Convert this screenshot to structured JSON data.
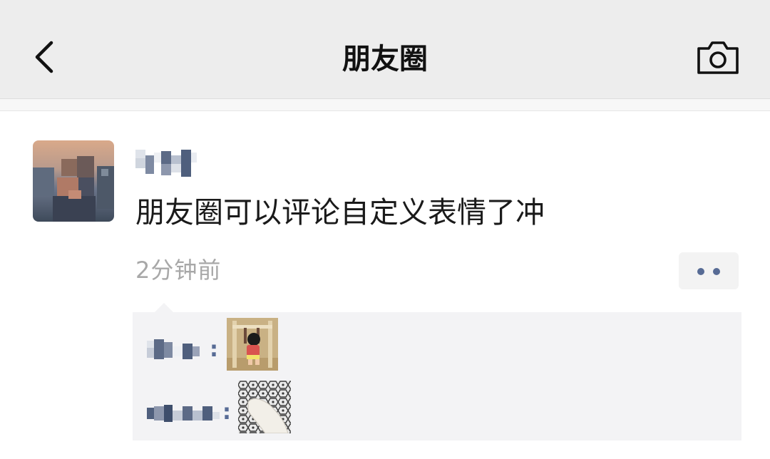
{
  "navbar": {
    "title": "朋友圈",
    "back_icon": "chevron-left-icon",
    "camera_icon": "camera-icon",
    "background": "#ededed"
  },
  "post": {
    "text": "朋友圈可以评论自定义表情了冲",
    "time": "2分钟前",
    "more_icon": "ellipsis-icon"
  },
  "comments": [
    {
      "separator": ":",
      "sticker": "hanging-cartoon-sticker"
    },
    {
      "separator": ":",
      "sticker": "cat-paw-sticker"
    }
  ],
  "colors": {
    "link_blue": "#576b95",
    "timestamp_gray": "#a8a8a8",
    "comment_bg": "#f3f3f5"
  }
}
